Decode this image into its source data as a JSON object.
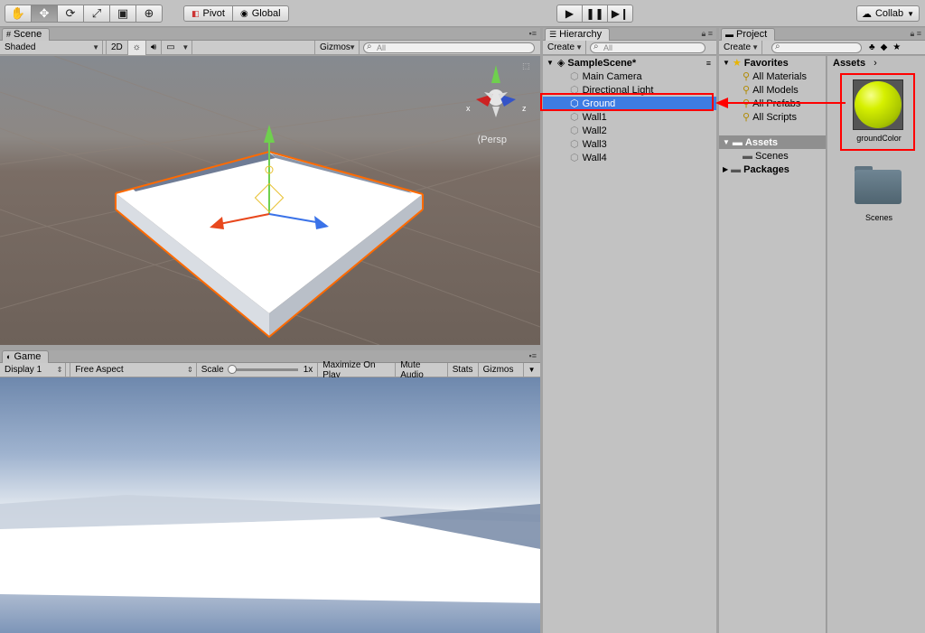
{
  "toolbar": {
    "tools": [
      "hand-icon",
      "move-icon",
      "rotate-icon",
      "scale-icon",
      "rect-icon",
      "transform-icon"
    ],
    "pivot_label": "Pivot",
    "global_label": "Global",
    "collab_label": "Collab"
  },
  "scene": {
    "tab_label": "Scene",
    "shading_mode": "Shaded",
    "mode_2d": "2D",
    "gizmos_label": "Gizmos",
    "search_placeholder": "All",
    "persp_label": "Persp",
    "axis_x": "x",
    "axis_z": "z"
  },
  "game": {
    "tab_label": "Game",
    "display": "Display 1",
    "aspect": "Free Aspect",
    "scale_label": "Scale",
    "scale_value": "1x",
    "maximize_label": "Maximize On Play",
    "mute_label": "Mute Audio",
    "stats_label": "Stats",
    "gizmos_label": "Gizmos"
  },
  "hierarchy": {
    "tab_label": "Hierarchy",
    "create_label": "Create",
    "search_placeholder": "All",
    "scene_name": "SampleScene*",
    "items": [
      {
        "label": "Main Camera",
        "selected": false
      },
      {
        "label": "Directional Light",
        "selected": false
      },
      {
        "label": "Ground",
        "selected": true
      },
      {
        "label": "Wall1",
        "selected": false
      },
      {
        "label": "Wall2",
        "selected": false
      },
      {
        "label": "Wall3",
        "selected": false
      },
      {
        "label": "Wall4",
        "selected": false
      }
    ]
  },
  "project": {
    "tab_label": "Project",
    "create_label": "Create",
    "favorites_label": "Favorites",
    "favorites": [
      "All Materials",
      "All Models",
      "All Prefabs",
      "All Scripts"
    ],
    "assets_label": "Assets",
    "scenes_label": "Scenes",
    "packages_label": "Packages",
    "breadcrumb": "Assets",
    "grid_items": [
      {
        "label": "groundColor",
        "type": "material"
      },
      {
        "label": "Scenes",
        "type": "folder"
      }
    ]
  },
  "colors": {
    "selection": "#3e7ce2",
    "highlight": "#ff0000",
    "material": "#c8f000"
  }
}
